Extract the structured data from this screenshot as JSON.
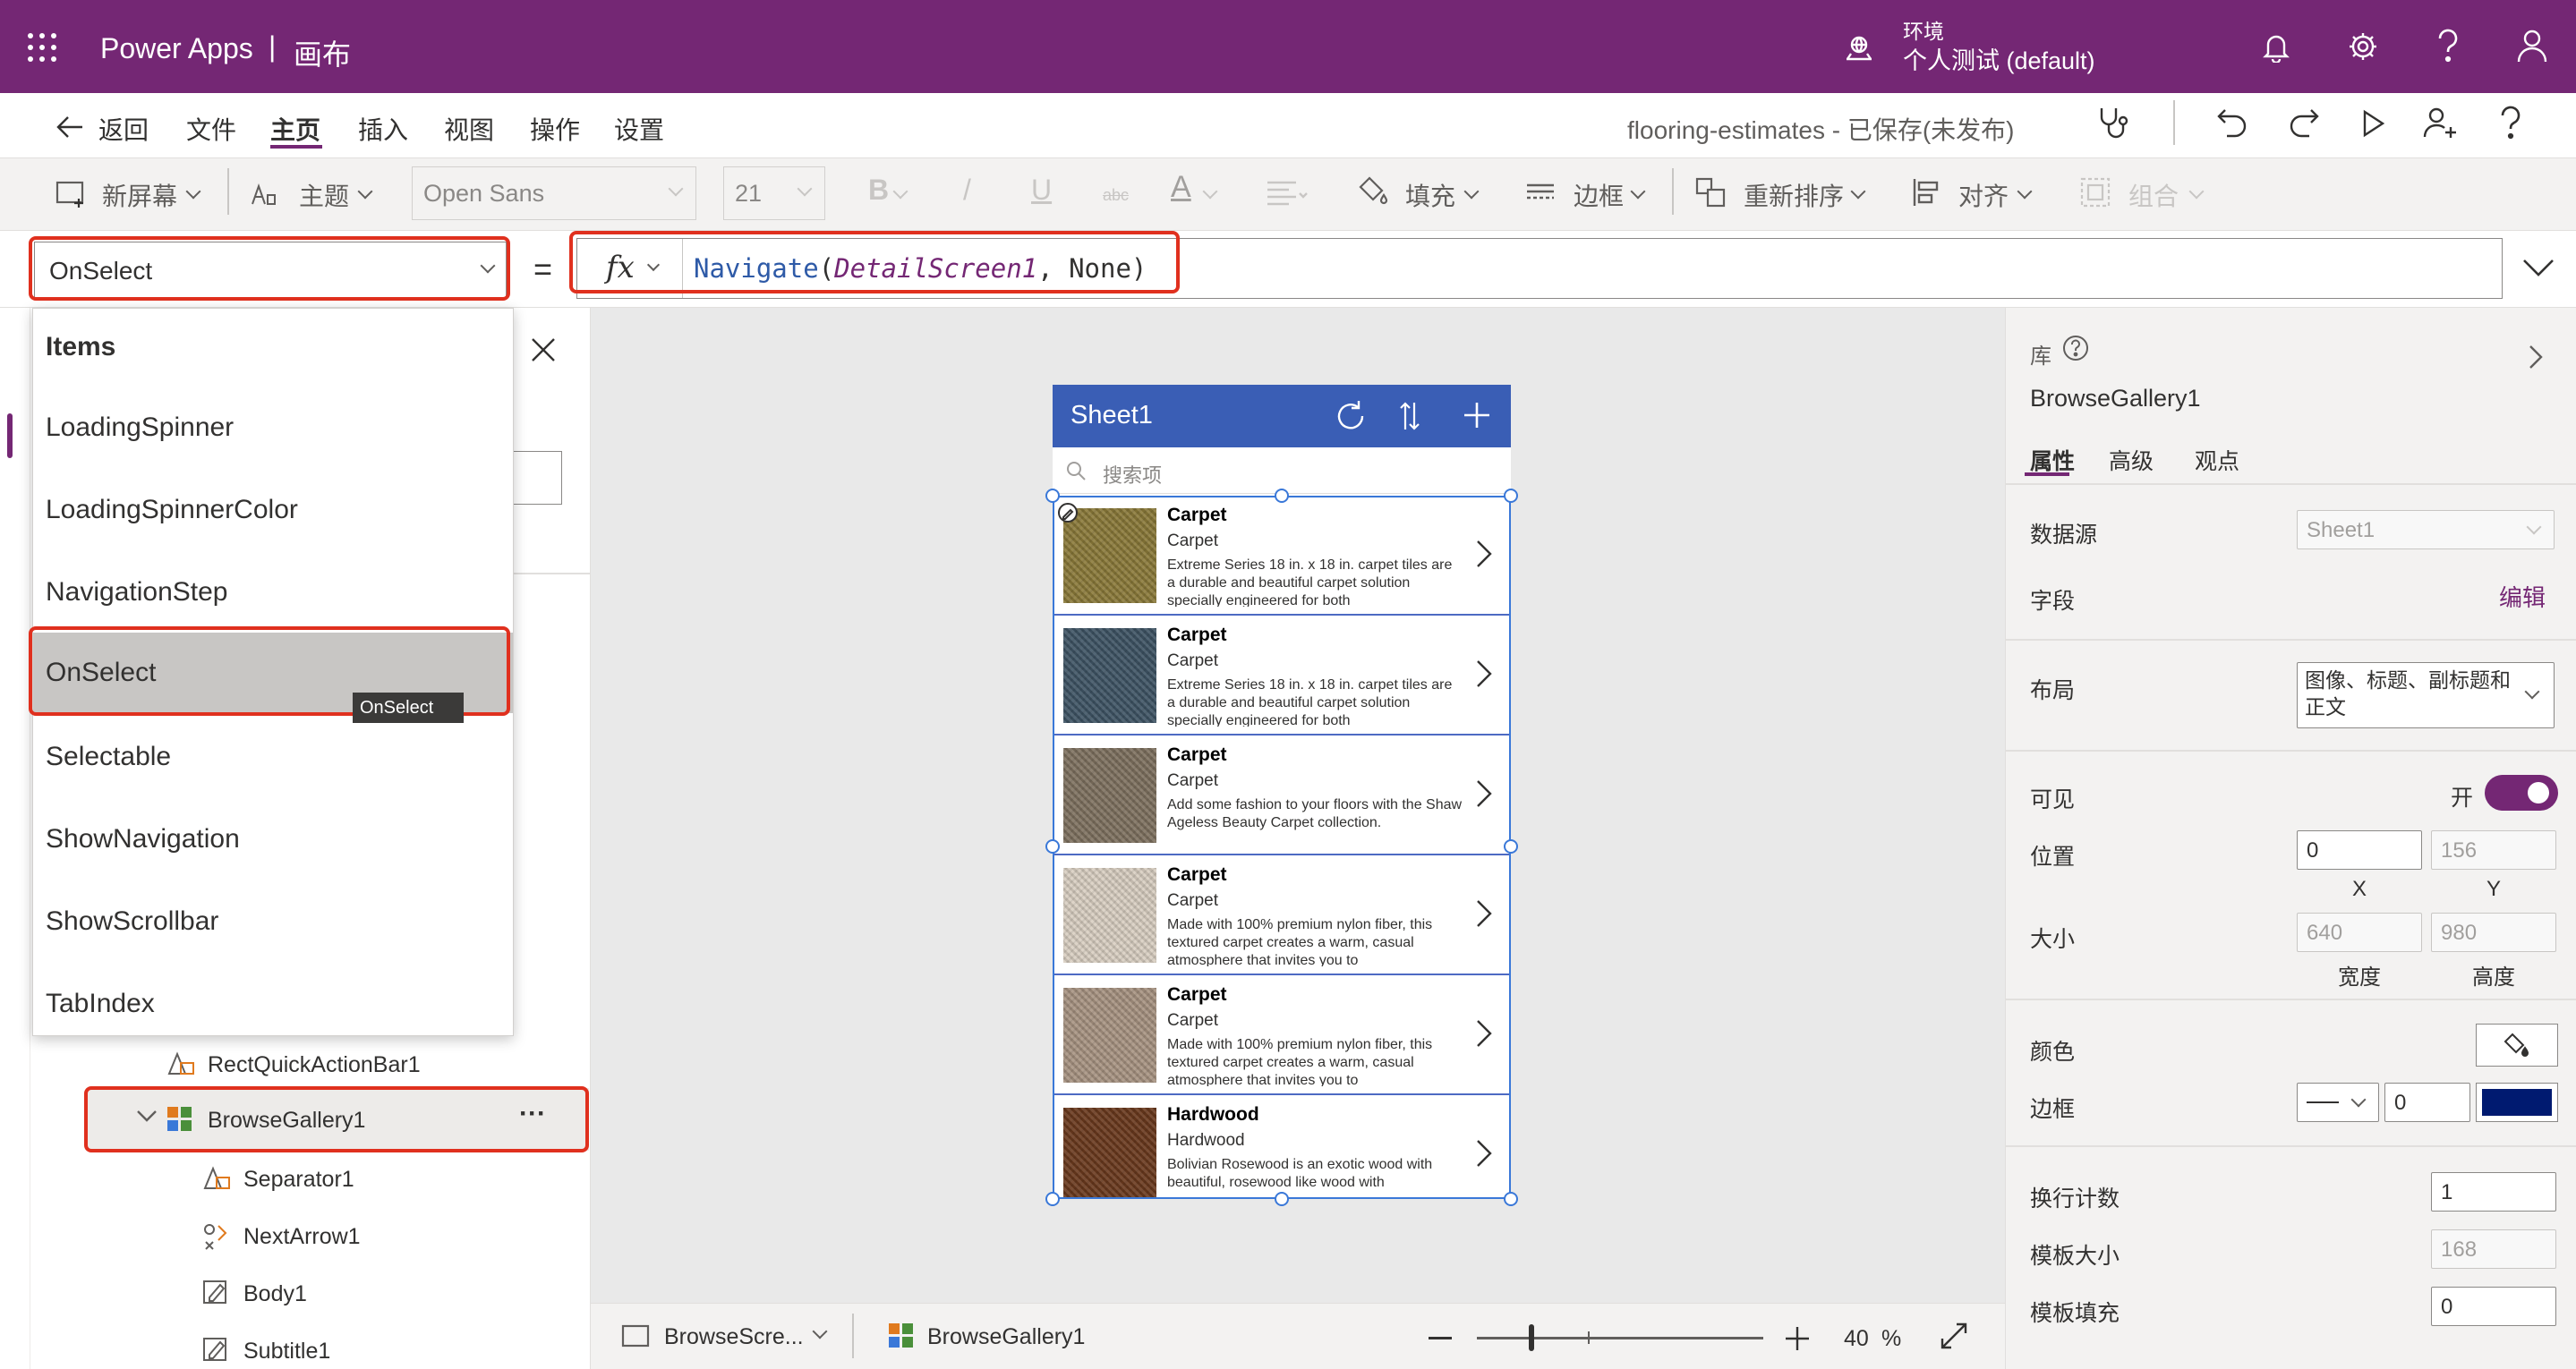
{
  "app": {
    "name": "Power Apps",
    "separator": "|",
    "section": "画布"
  },
  "env": {
    "label": "环境",
    "name": "个人测试 (default)"
  },
  "menu": {
    "back": "返回",
    "items": [
      "文件",
      "主页",
      "插入",
      "视图",
      "操作",
      "设置"
    ],
    "active": "主页",
    "doc_title": "flooring-estimates - 已保存(未发布)"
  },
  "ribbon": {
    "new_screen": "新屏幕",
    "theme": "主题",
    "font": "Open Sans",
    "font_size": "21",
    "bold": "B",
    "italic": "/",
    "underline": "U",
    "strike": "abc",
    "font_color": "A",
    "fill": "填充",
    "border": "边框",
    "reorder": "重新排序",
    "align": "对齐",
    "group": "组合"
  },
  "formula": {
    "property": "OnSelect",
    "equals": "=",
    "fx": "fx",
    "fn": "Navigate",
    "arg1": "DetailScreen1",
    "arg2": "None"
  },
  "property_dropdown": {
    "header": "Items",
    "items": [
      "LoadingSpinner",
      "LoadingSpinnerColor",
      "NavigationStep",
      "OnSelect",
      "Selectable",
      "ShowNavigation",
      "ShowScrollbar",
      "TabIndex"
    ],
    "selected": "OnSelect",
    "tooltip": "OnSelect"
  },
  "tree": {
    "items": [
      {
        "label": "RectQuickActionBar1",
        "icon": "rectangle-icon"
      },
      {
        "label": "BrowseGallery1",
        "icon": "gallery-icon",
        "selected": true
      },
      {
        "label": "Separator1",
        "icon": "separator-icon"
      },
      {
        "label": "NextArrow1",
        "icon": "arrow-icon"
      },
      {
        "label": "Body1",
        "icon": "label-icon"
      },
      {
        "label": "Subtitle1",
        "icon": "label-icon"
      }
    ],
    "more": "···"
  },
  "phone": {
    "title": "Sheet1",
    "search_placeholder": "搜索项",
    "rows": [
      {
        "title": "Carpet",
        "subtitle": "Carpet",
        "body": "Extreme Series 18 in. x 18 in. carpet tiles are a durable and beautiful carpet solution specially engineered for both",
        "color": "#8b7a3a"
      },
      {
        "title": "Carpet",
        "subtitle": "Carpet",
        "body": "Extreme Series 18 in. x 18 in. carpet tiles are a durable and beautiful carpet solution specially engineered for both",
        "color": "#3f5565"
      },
      {
        "title": "Carpet",
        "subtitle": "Carpet",
        "body": "Add some fashion to your floors with the Shaw Ageless Beauty Carpet collection.",
        "color": "#7f7260"
      },
      {
        "title": "Carpet",
        "subtitle": "Carpet",
        "body": "Made with 100% premium nylon fiber, this textured carpet creates a warm, casual atmosphere that invites you to",
        "color": "#d9cfc2"
      },
      {
        "title": "Carpet",
        "subtitle": "Carpet",
        "body": "Made with 100% premium nylon fiber, this textured carpet creates a warm, casual atmosphere that invites you to",
        "color": "#a89482"
      },
      {
        "title": "Hardwood",
        "subtitle": "Hardwood",
        "body": "Bolivian Rosewood is an exotic wood with beautiful, rosewood like wood with",
        "color": "#6b3a1e"
      }
    ]
  },
  "status": {
    "screen": "BrowseScre...",
    "gallery": "BrowseGallery1",
    "zoom": "40",
    "zoom_unit": "%"
  },
  "right_panel": {
    "lib_label": "库",
    "control_name": "BrowseGallery1",
    "tabs": [
      "属性",
      "高级",
      "观点"
    ],
    "datasource_label": "数据源",
    "datasource_value": "Sheet1",
    "fields_label": "字段",
    "fields_edit": "编辑",
    "layout_label": "布局",
    "layout_value": "图像、标题、副标题和正文",
    "visible_label": "可见",
    "visible_state": "开",
    "position_label": "位置",
    "pos_x": "0",
    "pos_y": "156",
    "x_cap": "X",
    "y_cap": "Y",
    "size_label": "大小",
    "width": "640",
    "height": "980",
    "width_cap": "宽度",
    "height_cap": "高度",
    "color_label": "颜色",
    "border_label": "边框",
    "border_width": "0",
    "border_color": "#001a70",
    "wrap_label": "换行计数",
    "wrap_value": "1",
    "template_size_label": "模板大小",
    "template_size_value": "168",
    "template_padding_label": "模板填充",
    "template_padding_value": "0"
  },
  "colors": {
    "brand": "#742774",
    "app_header": "#3a5eb5",
    "highlight": "#e0301e"
  }
}
